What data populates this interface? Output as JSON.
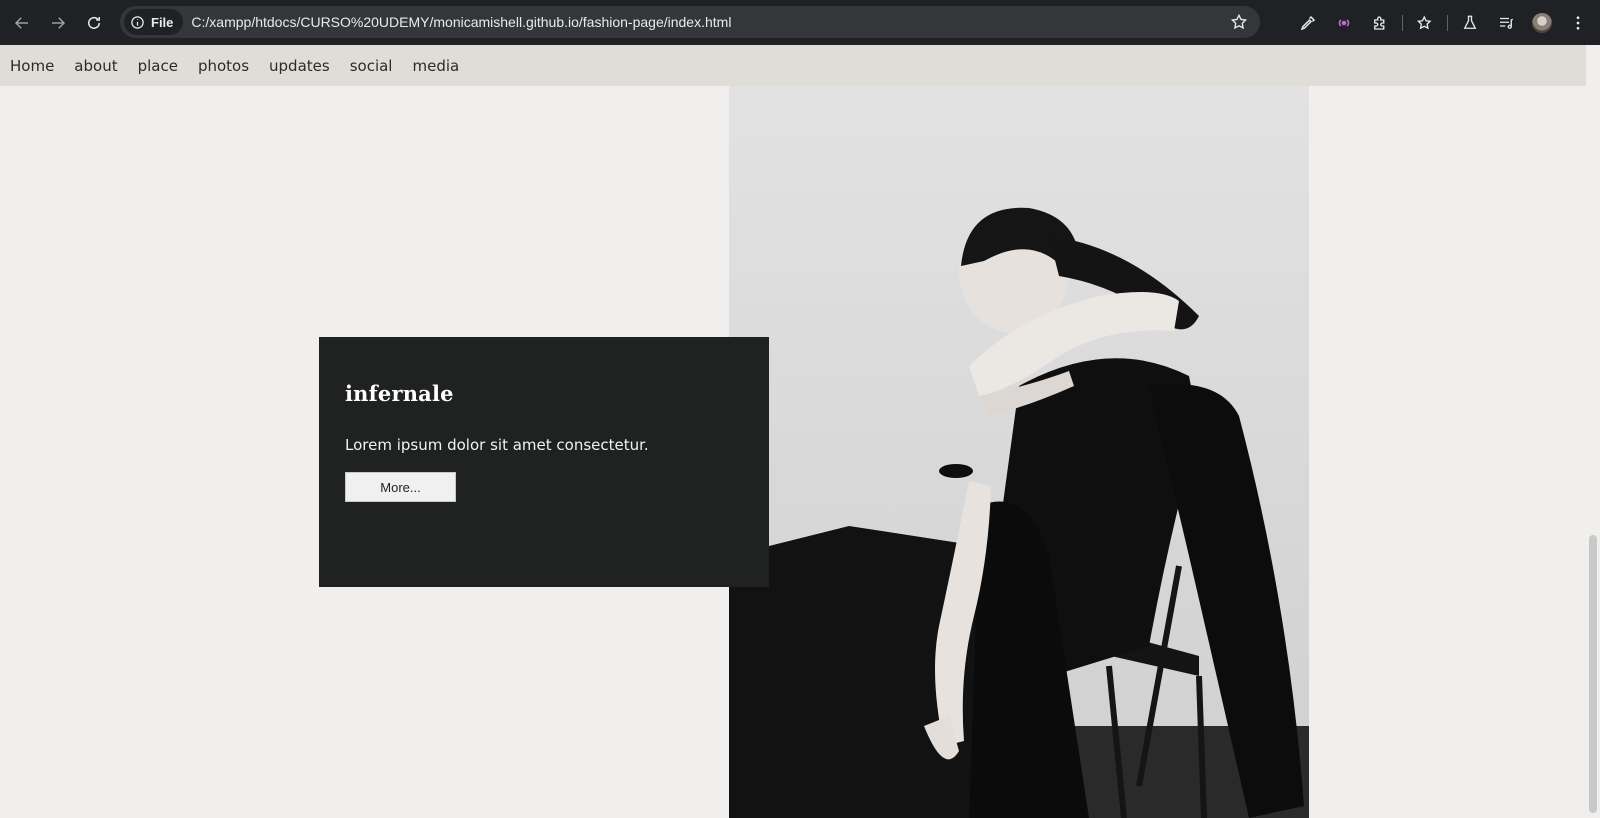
{
  "browser": {
    "site_chip": "File",
    "url": "C:/xampp/htdocs/CURSO%20UDEMY/monicamishell.github.io/fashion-page/index.html",
    "icons": [
      "back-icon",
      "forward-icon",
      "reload-icon",
      "info-icon",
      "bookmark-star-icon",
      "eyedropper-icon",
      "broadcast-icon",
      "extensions-icon",
      "bookmarks-icon",
      "labs-icon",
      "media-queue-icon",
      "profile-avatar",
      "menu-icon"
    ]
  },
  "nav": {
    "items": [
      {
        "label": "Home"
      },
      {
        "label": "about"
      },
      {
        "label": "place"
      },
      {
        "label": "photos"
      },
      {
        "label": "updates"
      },
      {
        "label": "social"
      },
      {
        "label": "media"
      }
    ]
  },
  "card": {
    "title": "infernale",
    "text": "Lorem ipsum dolor sit amet consectetur.",
    "button_label": "More..."
  }
}
